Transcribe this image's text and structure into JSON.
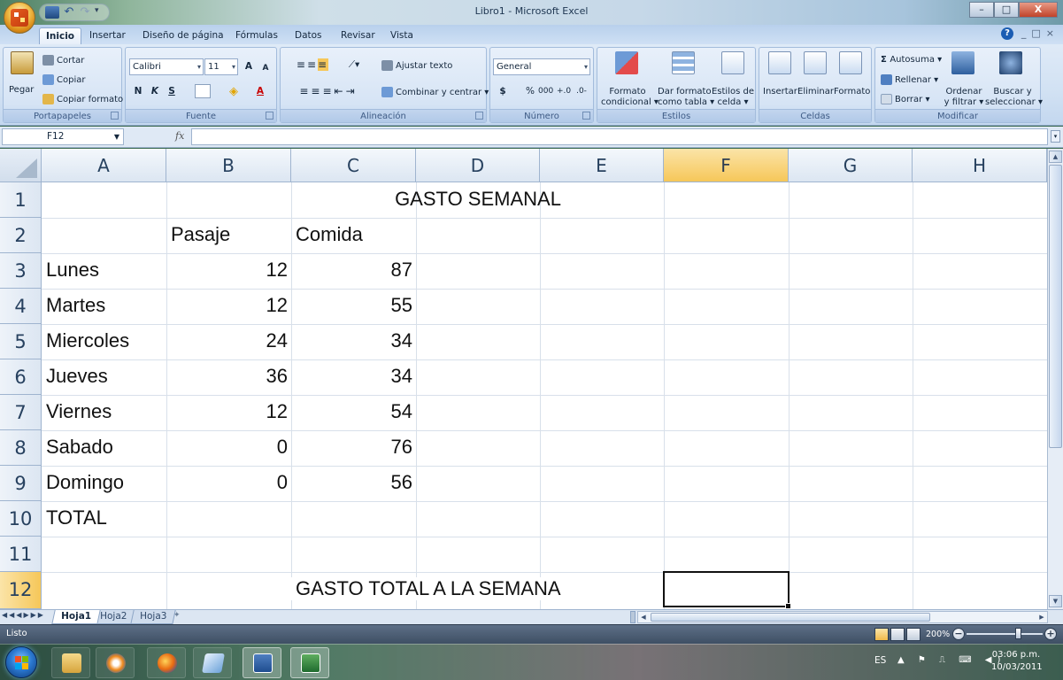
{
  "window": {
    "title": "Libro1 - Microsoft Excel",
    "controls": [
      "–",
      "□",
      "X"
    ]
  },
  "quick_access": {
    "icons": [
      "save-icon",
      "undo-icon",
      "redo-icon",
      "customize-icon"
    ]
  },
  "ribbon_tabs": [
    "Inicio",
    "Insertar",
    "Diseño de página",
    "Fórmulas",
    "Datos",
    "Revisar",
    "Vista"
  ],
  "active_tab": "Inicio",
  "ribbon": {
    "portapapeles": {
      "title": "Portapapeles",
      "paste": "Pegar",
      "cut": "Cortar",
      "copy": "Copiar",
      "copy_format": "Copiar formato"
    },
    "fuente": {
      "title": "Fuente",
      "font": "Calibri",
      "size": "11",
      "grow": "A",
      "shrink": "A",
      "bold": "N",
      "italic": "K",
      "underline": "S"
    },
    "alineacion": {
      "title": "Alineación",
      "wrap": "Ajustar texto",
      "merge": "Combinar y centrar"
    },
    "numero": {
      "title": "Número",
      "format": "General",
      "currency": "$",
      "percent": "%",
      "thousands": "000"
    },
    "estilos": {
      "title": "Estilos",
      "cond_l1": "Formato",
      "cond_l2": "condicional",
      "table_l1": "Dar formato",
      "table_l2": "como tabla",
      "cell_l1": "Estilos de",
      "cell_l2": "celda"
    },
    "celdas": {
      "title": "Celdas",
      "insert": "Insertar",
      "delete": "Eliminar",
      "format": "Formato"
    },
    "modificar": {
      "title": "Modificar",
      "autosum": "Autosuma",
      "fill": "Rellenar",
      "clear": "Borrar",
      "sort_l1": "Ordenar",
      "sort_l2": "y filtrar",
      "find_l1": "Buscar y",
      "find_l2": "seleccionar"
    }
  },
  "formula_bar": {
    "name_box": "F12",
    "fx": "fx",
    "value": ""
  },
  "sheet": {
    "columns": [
      "A",
      "B",
      "C",
      "D",
      "E",
      "F",
      "G",
      "H"
    ],
    "selected_column": "F",
    "rows": [
      "1",
      "2",
      "3",
      "4",
      "5",
      "6",
      "7",
      "8",
      "9",
      "10",
      "11",
      "12"
    ],
    "selected_row": "12",
    "title": "GASTO SEMANAL",
    "headers": {
      "b": "Pasaje",
      "c": "Comida"
    },
    "data": [
      {
        "day": "Lunes",
        "pasaje": "12",
        "comida": "87"
      },
      {
        "day": "Martes",
        "pasaje": "12",
        "comida": "55"
      },
      {
        "day": "Miercoles",
        "pasaje": "24",
        "comida": "34"
      },
      {
        "day": "Jueves",
        "pasaje": "36",
        "comida": "34"
      },
      {
        "day": "Viernes",
        "pasaje": "12",
        "comida": "54"
      },
      {
        "day": "Sabado",
        "pasaje": "0",
        "comida": "76"
      },
      {
        "day": "Domingo",
        "pasaje": "0",
        "comida": "56"
      }
    ],
    "total_label": "TOTAL",
    "summary_label": "GASTO TOTAL A LA SEMANA",
    "active_cell": "F12"
  },
  "sheet_tabs": [
    "Hoja1",
    "Hoja2",
    "Hoja3"
  ],
  "active_sheet": "Hoja1",
  "status": {
    "text": "Listo",
    "zoom": "200%"
  },
  "taskbar": {
    "apps": [
      "explorer-icon",
      "media-player-icon",
      "firefox-icon",
      "notes-icon",
      "word-icon",
      "excel-icon"
    ],
    "language": "ES",
    "time": "03:06 p.m.",
    "date": "10/03/2011"
  },
  "colors": {
    "accent_selection": "#f6c759",
    "ribbon": "#d1e1f3",
    "grid_lines": "#d8e0ea"
  }
}
